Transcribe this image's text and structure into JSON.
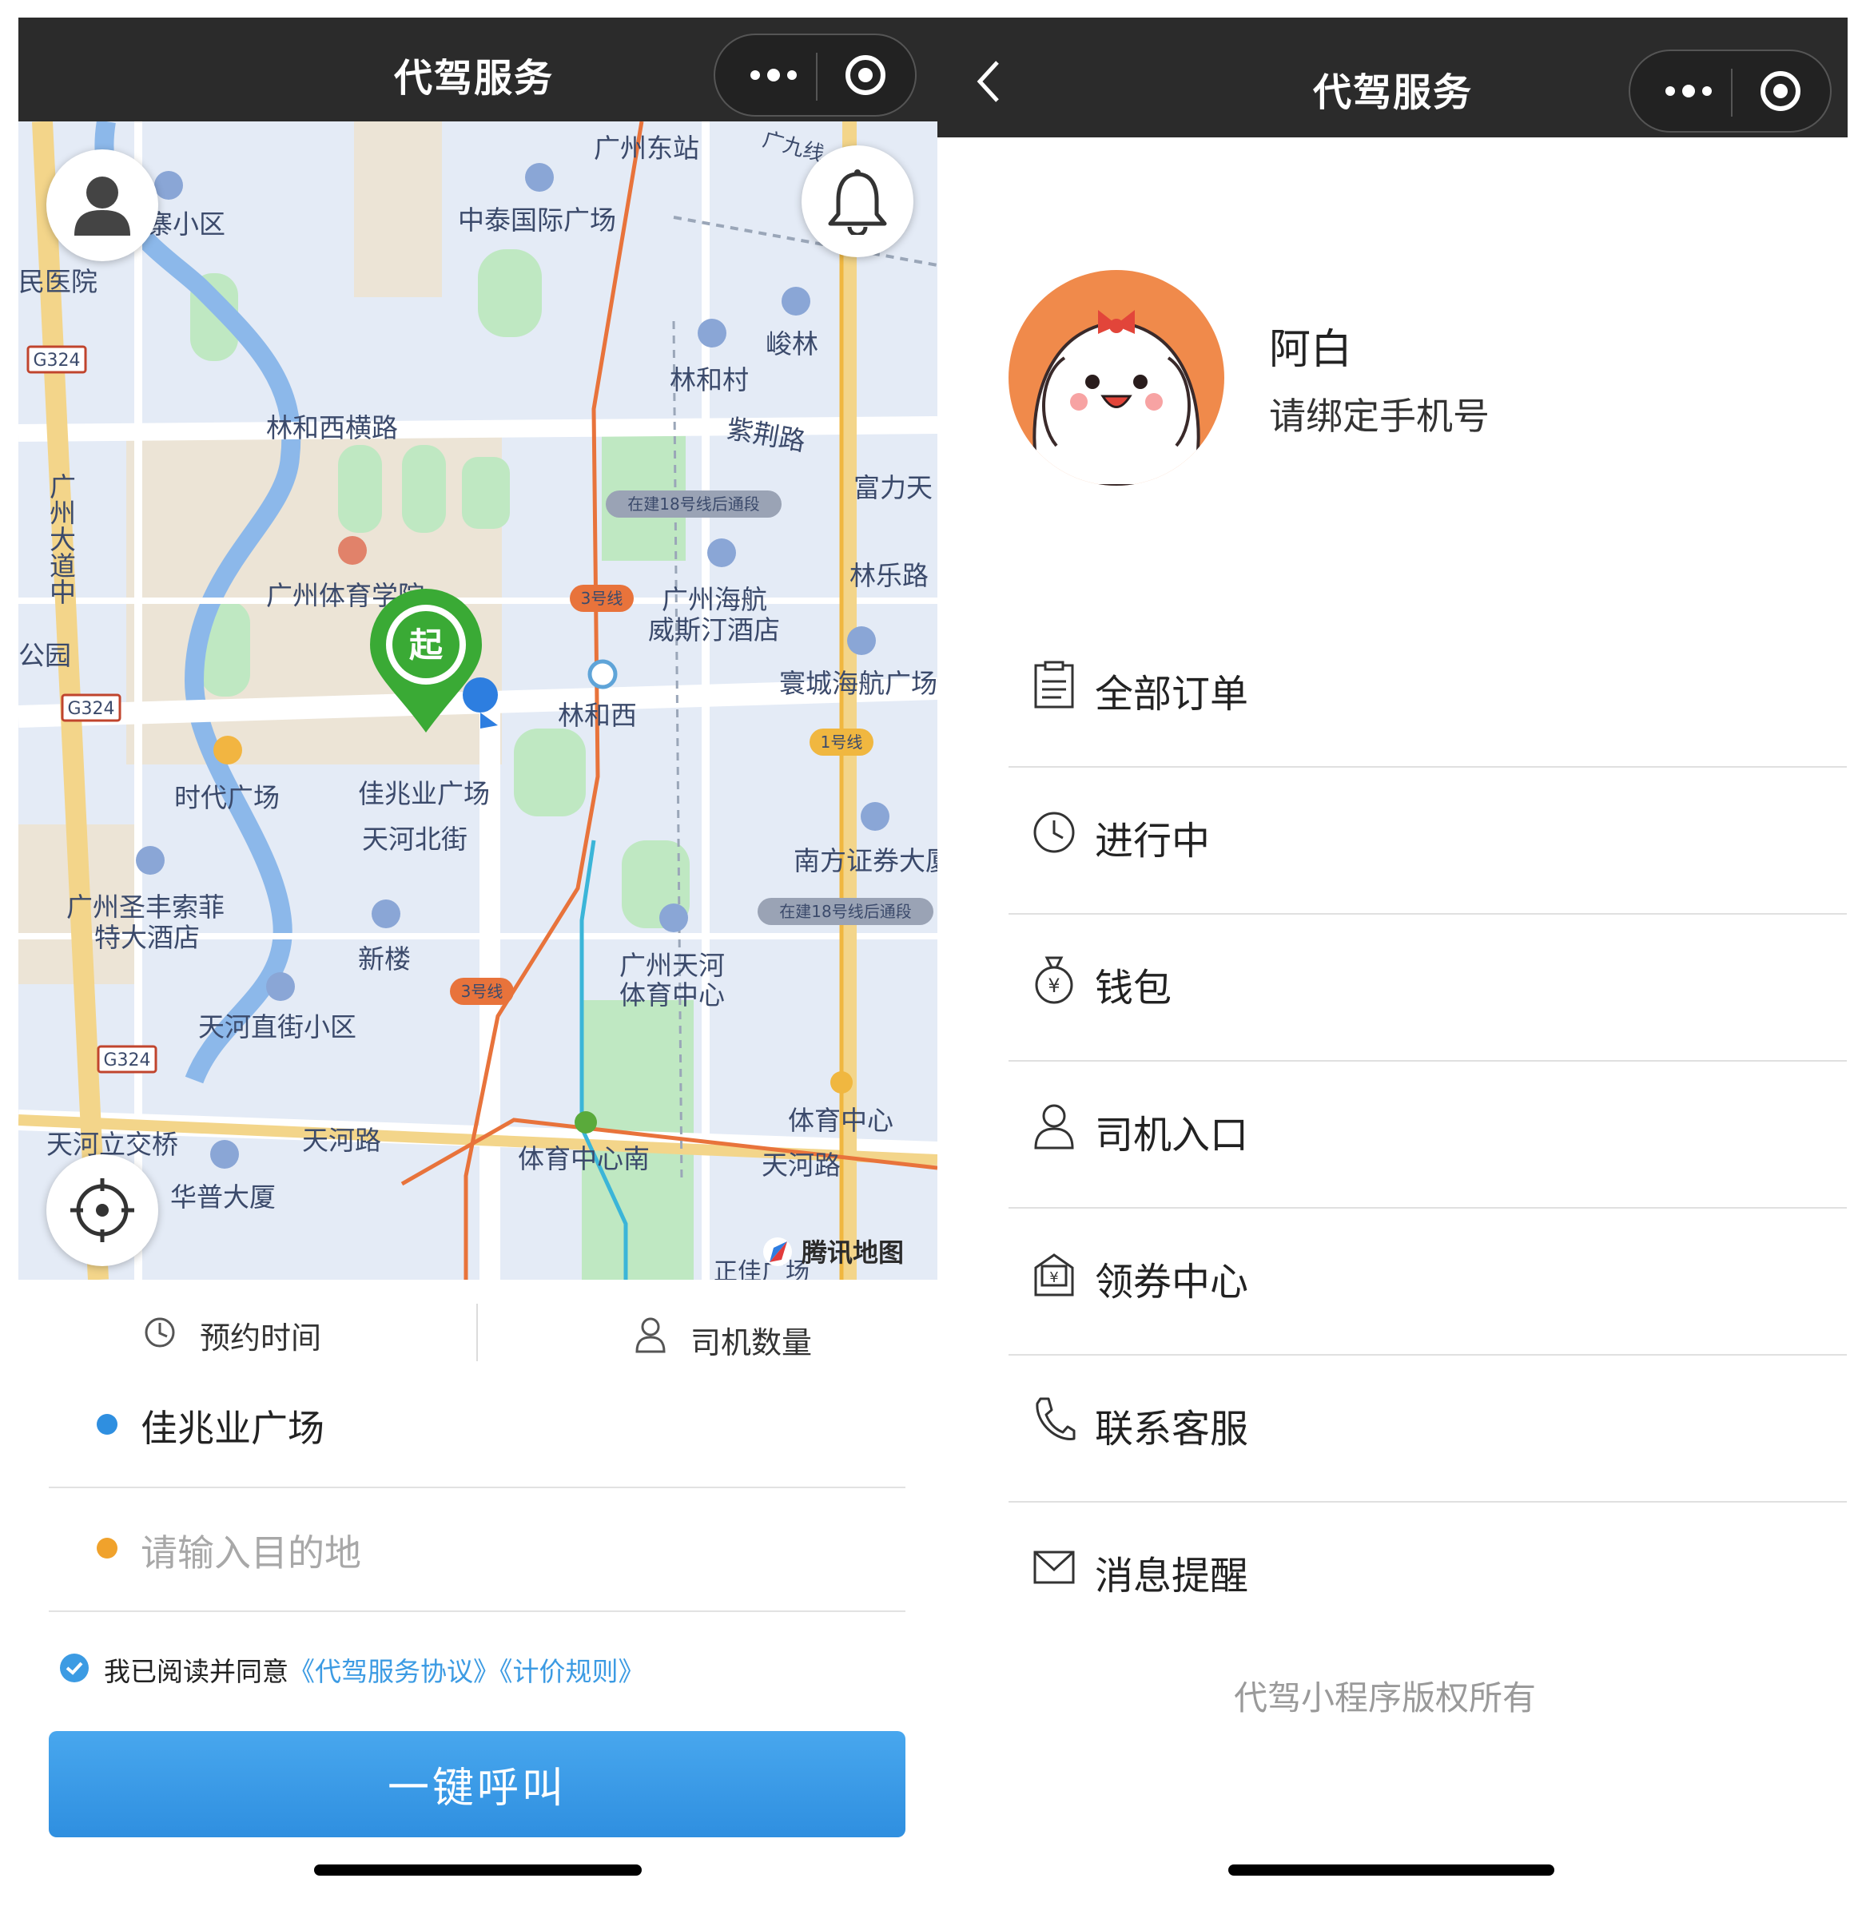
{
  "left": {
    "title": "代驾服务",
    "map": {
      "start_marker": "起",
      "attribution": "腾讯地图",
      "places": {
        "guangzhou_east_station": "广州东站",
        "guangjiu_line": "广九线",
        "zhongtai_plaza": "中泰国际广场",
        "zhai_community": "寨小区",
        "hospital": "民医院",
        "g324_a": "G324",
        "junlin": "峻林",
        "linhe_village": "林和村",
        "zijing_road": "紫荆路",
        "linhe_west_cross": "林和西横路",
        "guangzhou_avenue_a": "广州大道中",
        "line18_a": "在建18号线后通段",
        "fuli": "富力天",
        "linle_road": "林乐路",
        "sports_institute": "广州体育学院",
        "line3_a": "3号线",
        "haihang_hotel_1": "广州海航",
        "haihang_hotel_2": "威斯汀酒店",
        "park": "公园",
        "g324_b": "G324",
        "linhexi": "林和西",
        "huancheng_plaza": "寰城海航广场",
        "line1": "1号线",
        "times_square": "时代广场",
        "jiazhaoye_plaza": "佳兆业广场",
        "tianhe_north_st": "天河北街",
        "southern_securities": "南方证券大厦",
        "line18_b": "在建18号线后通段",
        "sofitel_1": "广州圣丰索菲",
        "sofitel_2": "特大酒店",
        "xinlou": "新楼",
        "tianhe_sports_1": "广州天河",
        "tianhe_sports_2": "体育中心",
        "line3_b": "3号线",
        "tianhe_zhijie": "天河直街小区",
        "g324_c": "G324",
        "sports_center": "体育中心",
        "tianli_interchange": "天河立交桥",
        "tianhe_road_a": "天河路",
        "sports_center_south": "体育中心南",
        "tianhe_road_b": "天河路",
        "huapu_building": "华普大厦",
        "zhengjia": "正佳广场"
      }
    },
    "options": {
      "reserve_time": "预约时间",
      "driver_count": "司机数量"
    },
    "start_address": "佳兆业广场",
    "destination_placeholder": "请输入目的地",
    "agreement": {
      "prefix": "我已阅读并同意",
      "service_agreement": "《代驾服务协议》",
      "pricing_rules": "《计价规则》"
    },
    "call_button": "一键呼叫"
  },
  "right": {
    "title": "代驾服务",
    "profile": {
      "name": "阿白",
      "bind_phone": "请绑定手机号"
    },
    "menu": [
      {
        "label": "全部订单",
        "icon": "clipboard-icon"
      },
      {
        "label": "进行中",
        "icon": "clock-icon"
      },
      {
        "label": "钱包",
        "icon": "money-bag-icon"
      },
      {
        "label": "司机入口",
        "icon": "person-icon"
      },
      {
        "label": "领券中心",
        "icon": "coupon-icon"
      },
      {
        "label": "联系客服",
        "icon": "phone-icon"
      },
      {
        "label": "消息提醒",
        "icon": "mail-icon"
      }
    ],
    "copyright": "代驾小程序版权所有"
  },
  "colors": {
    "topbar": "#2b2b2b",
    "accent_blue": "#2f8fe0",
    "link_blue": "#3c9be3",
    "destination_dot": "#f0a22c",
    "start_pin_green": "#3aaa35",
    "avatar_orange": "#f08a4b"
  }
}
